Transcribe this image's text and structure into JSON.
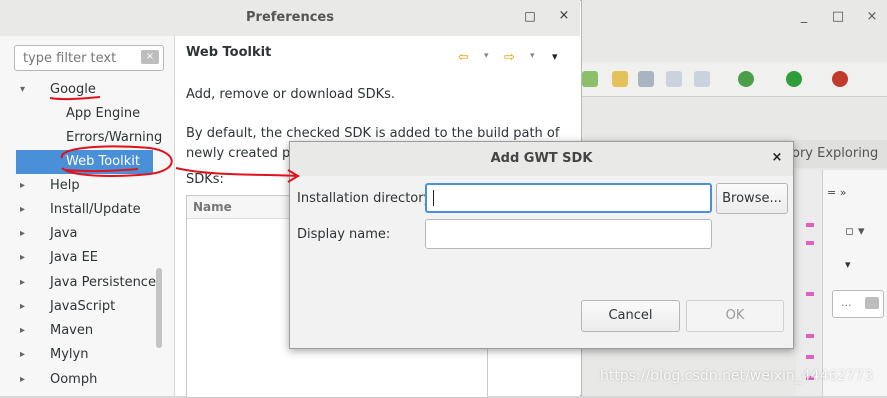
{
  "preferences": {
    "title": "Preferences",
    "filter_placeholder": "type filter text",
    "tree": [
      {
        "label": "Google",
        "expanded": true,
        "level": 0
      },
      {
        "label": "App Engine",
        "level": 1
      },
      {
        "label": "Errors/Warning",
        "level": 1
      },
      {
        "label": "Web Toolkit",
        "level": 1,
        "selected": true
      },
      {
        "label": "Help",
        "level": 0
      },
      {
        "label": "Install/Update",
        "level": 0
      },
      {
        "label": "Java",
        "level": 0
      },
      {
        "label": "Java EE",
        "level": 0
      },
      {
        "label": "Java Persistence",
        "level": 0
      },
      {
        "label": "JavaScript",
        "level": 0
      },
      {
        "label": "Maven",
        "level": 0
      },
      {
        "label": "Mylyn",
        "level": 0
      },
      {
        "label": "Oomph",
        "level": 0
      }
    ],
    "page": {
      "title": "Web Toolkit",
      "description": "Add, remove or download SDKs.",
      "description2": "By default, the checked SDK is added to the build path of newly created projects.",
      "sdks_label": "SDKs:",
      "table_header_name": "Name"
    }
  },
  "gwt_dialog": {
    "title": "Add GWT SDK",
    "installation_label": "Installation directory:",
    "installation_value": "",
    "display_label": "Display name:",
    "display_value": "",
    "browse_label": "Browse...",
    "cancel_label": "Cancel",
    "ok_label": "OK"
  },
  "background": {
    "tab_partial": "ory Exploring",
    "mini_search": "..."
  },
  "watermark": "https://blog.csdn.net/weixin_44462773",
  "colors": {
    "selection": "#4a90d9",
    "annotation_red": "#e0121b",
    "focus_border": "#4a90d9"
  },
  "icons": {
    "close": "×",
    "maximize": "□",
    "minimize": "_",
    "back": "⇦",
    "forward": "⇨",
    "dropdown": "▾",
    "collapsed": "▸",
    "expanded": "▾"
  }
}
